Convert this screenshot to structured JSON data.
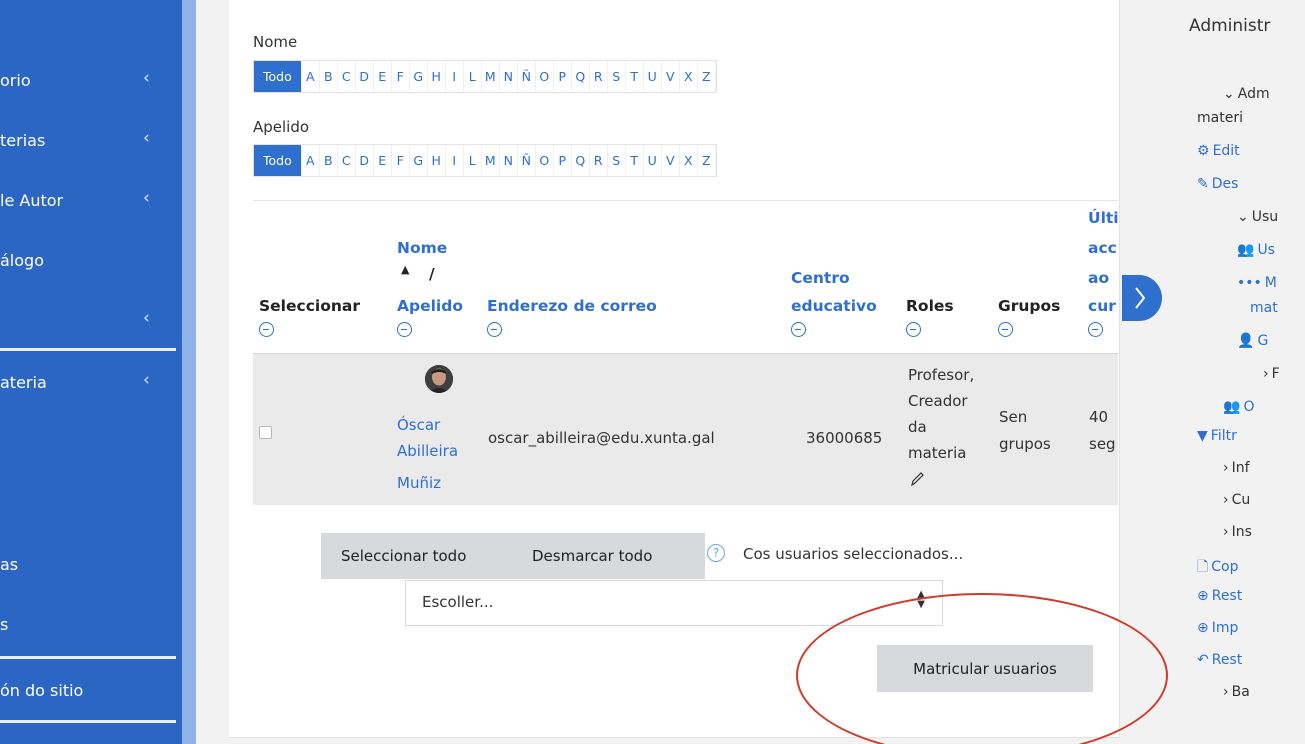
{
  "sidebar": {
    "items": [
      {
        "label": "orio",
        "chevron": true
      },
      {
        "label": "terias",
        "chevron": true
      },
      {
        "label": "le Autor",
        "chevron": true
      },
      {
        "label": "álogo",
        "chevron": false
      },
      {
        "label": "",
        "chevron": true
      },
      {
        "label": "ateria",
        "chevron": true
      },
      {
        "label": "as",
        "chevron": false
      },
      {
        "label": "s",
        "chevron": false
      },
      {
        "label": "ón do sitio",
        "chevron": false
      }
    ]
  },
  "filters": {
    "nome_label": "Nome",
    "apelido_label": "Apelido",
    "all_label": "Todo",
    "letters": [
      "A",
      "B",
      "C",
      "D",
      "E",
      "F",
      "G",
      "H",
      "I",
      "L",
      "M",
      "N",
      "Ñ",
      "O",
      "P",
      "Q",
      "R",
      "S",
      "T",
      "U",
      "V",
      "X",
      "Z"
    ]
  },
  "table": {
    "headers": {
      "select": "Seleccionar",
      "nome": "Nome",
      "sort_arrow": "▲",
      "slash": "/",
      "apelido": "Apelido",
      "email": "Enderezo de correo",
      "centro1": "Centro",
      "centro2": "educativo",
      "roles": "Roles",
      "grupos": "Grupos",
      "last1": "Últi",
      "last2": "acc",
      "last3": "ao",
      "last4": "cur"
    },
    "row": {
      "name1": "Óscar",
      "name2": "Abilleira",
      "name3": "Muñiz",
      "email": "oscar_abilleira@edu.xunta.gal",
      "centro": "36000685",
      "roles1": "Profesor,",
      "roles2": "Creador",
      "roles3": "da",
      "roles4": "materia",
      "grupos1": "Sen",
      "grupos2": "grupos",
      "last1": "40",
      "last2": "seg"
    }
  },
  "actions": {
    "select_all": "Seleccionar todo",
    "deselect_all": "Desmarcar todo",
    "with_selected": "Cos usuarios seleccionados...",
    "choose": "Escoller...",
    "enrol": "Matricular usuarios"
  },
  "right_panel": {
    "title": "Administr",
    "items": [
      {
        "text": "Adm",
        "prefix": "⌄",
        "color": "dark"
      },
      {
        "text": "materi",
        "prefix": "",
        "color": "dark"
      },
      {
        "text": "Edit",
        "prefix": "⚙",
        "color": "blue"
      },
      {
        "text": "Des",
        "prefix": "✎",
        "color": "blue"
      },
      {
        "text": "Usu",
        "prefix": "⌄",
        "color": "dark"
      },
      {
        "text": "Us",
        "prefix": "👥",
        "color": "blue"
      },
      {
        "text": "M",
        "prefix": "•••",
        "color": "blue"
      },
      {
        "text": "mat",
        "prefix": "",
        "color": "blue"
      },
      {
        "text": "G",
        "prefix": "👤",
        "color": "blue"
      },
      {
        "text": "F",
        "prefix": "›",
        "color": "dark"
      },
      {
        "text": "O",
        "prefix": "👥",
        "color": "blue"
      },
      {
        "text": "Filtr",
        "prefix": "▼",
        "color": "blue"
      },
      {
        "text": "Inf",
        "prefix": "›",
        "color": "dark"
      },
      {
        "text": "Cu",
        "prefix": "›",
        "color": "dark"
      },
      {
        "text": "Ins",
        "prefix": "›",
        "color": "dark"
      },
      {
        "text": "Cop",
        "prefix": "🗋",
        "color": "blue"
      },
      {
        "text": "Rest",
        "prefix": "⊕",
        "color": "blue"
      },
      {
        "text": "Imp",
        "prefix": "⊕",
        "color": "blue"
      },
      {
        "text": "Rest",
        "prefix": "↶",
        "color": "blue"
      },
      {
        "text": "Ba",
        "prefix": "›",
        "color": "dark"
      }
    ]
  },
  "colors": {
    "brand": "#2f6fce",
    "sidebar": "#2c66c4",
    "highlight": "#d23a2a"
  }
}
